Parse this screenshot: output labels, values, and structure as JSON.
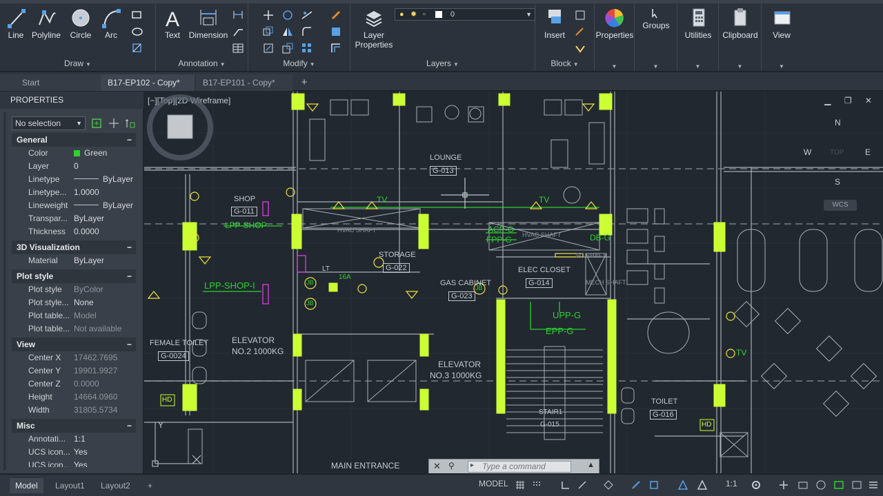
{
  "ribbon": {
    "draw": {
      "label": "Draw",
      "line": "Line",
      "polyline": "Polyline",
      "circle": "Circle",
      "arc": "Arc"
    },
    "annotation": {
      "label": "Annotation",
      "text": "Text",
      "dimension": "Dimension"
    },
    "modify": {
      "label": "Modify"
    },
    "layers": {
      "label": "Layers",
      "layer_properties_line1": "Layer",
      "layer_properties_line2": "Properties",
      "current_layer": "0"
    },
    "block": {
      "label": "Block",
      "insert": "Insert"
    },
    "properties": "Properties",
    "groups": "Groups",
    "utilities": "Utilities",
    "clipboard": "Clipboard",
    "view": "View"
  },
  "tabs": [
    {
      "label": "Start"
    },
    {
      "label": "B17-EP102 - Copy*"
    },
    {
      "label": "B17-EP101 - Copy*"
    },
    {
      "label": "+"
    }
  ],
  "properties_palette": {
    "title": "PROPERTIES",
    "selection": "No selection",
    "sections": {
      "general": {
        "title": "General",
        "rows": [
          {
            "key": "Color",
            "value": "Green"
          },
          {
            "key": "Layer",
            "value": "0"
          },
          {
            "key": "Linetype",
            "value": "ByLayer"
          },
          {
            "key": "Linetype...",
            "value": "1.0000"
          },
          {
            "key": "Lineweight",
            "value": "ByLayer"
          },
          {
            "key": "Transpar...",
            "value": "ByLayer"
          },
          {
            "key": "Thickness",
            "value": "0.0000"
          }
        ]
      },
      "visualization": {
        "title": "3D Visualization",
        "rows": [
          {
            "key": "Material",
            "value": "ByLayer"
          }
        ]
      },
      "plot": {
        "title": "Plot style",
        "rows": [
          {
            "key": "Plot style",
            "value": "ByColor"
          },
          {
            "key": "Plot style...",
            "value": "None"
          },
          {
            "key": "Plot table...",
            "value": "Model"
          },
          {
            "key": "Plot table...",
            "value": "Not available"
          }
        ]
      },
      "view": {
        "title": "View",
        "rows": [
          {
            "key": "Center X",
            "value": "17462.7695"
          },
          {
            "key": "Center Y",
            "value": "19901.9927"
          },
          {
            "key": "Center Z",
            "value": "0.0000"
          },
          {
            "key": "Height",
            "value": "14664.0960"
          },
          {
            "key": "Width",
            "value": "31805.5734"
          }
        ]
      },
      "misc": {
        "title": "Misc",
        "rows": [
          {
            "key": "Annotati...",
            "value": "1:1"
          },
          {
            "key": "UCS icon...",
            "value": "Yes"
          },
          {
            "key": "UCS icon...",
            "value": "Yes"
          }
        ]
      }
    }
  },
  "viewport": {
    "label": "[−][Top][2D Wireframe]",
    "viewcube": {
      "n": "N",
      "s": "S",
      "e": "E",
      "w": "W",
      "face": "TOP"
    },
    "wcs": "WCS"
  },
  "drawing_text": {
    "lounge": "LOUNGE",
    "lounge_id": "G-013",
    "shop": "SHOP",
    "shop_id": "G-011",
    "lpp_shop_top": "LPP-SHOP",
    "lpp_shop": "LPP-SHOP-I",
    "tv1": "TV",
    "tv2": "TV",
    "tv3": "TV",
    "hvac1": "HVAC SHAFT",
    "hvac2": "HVAC SHAFT",
    "acp": "ACP-G",
    "fpp": "FPP-G",
    "db": "DB-G",
    "storage": "STORAGE",
    "storage_id": "G-022",
    "elec": "ELEC CLOSET",
    "elec_id": "G-014",
    "gas": "GAS CABINET",
    "gas_id": "G-023",
    "upp": "UPP-G",
    "epp": "EPP-G",
    "elevator2": "ELEVATOR",
    "elevator2_cap": "NO.2  1000KG",
    "elevator3": "ELEVATOR",
    "elevator3_cap": "NO.3  1000KG",
    "female": "FEMALE TOILET",
    "female_id": "G-0024",
    "toilet": "TOILET",
    "toilet_id": "G-016",
    "stair": "STAIR1",
    "stair_id": "G-015",
    "main_entrance": "MAIN ENTRANCE",
    "hd1": "HD",
    "hd2": "HD",
    "jb1": "JB",
    "jb2": "JB",
    "jb3": "JB",
    "lt": "LT",
    "sixa": "16A",
    "mech": "MECH SHAFT",
    "sc": "SC SHAFT"
  },
  "command_line": {
    "placeholder": "Type a command"
  },
  "status": {
    "layout_tabs": [
      "Model",
      "Layout1",
      "Layout2",
      "+"
    ],
    "model": "MODEL",
    "scale": "1:1"
  },
  "colors": {
    "ribbon_bg": "#2b323b",
    "canvas_bg": "#212830",
    "accent_green": "#2ed12e",
    "highlight_yellow": "#ccff33",
    "cad_line": "#a9aeb6"
  }
}
